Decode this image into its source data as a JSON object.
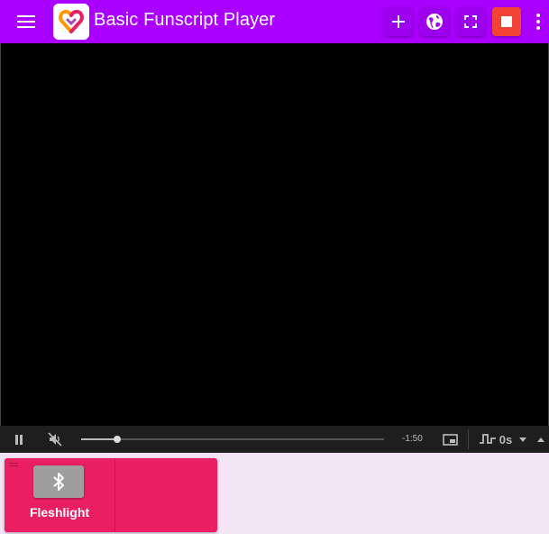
{
  "header": {
    "title": "Basic Funscript Player",
    "menu_icon": "menu-icon",
    "logo_icon": "heart-logo-icon",
    "actions": [
      {
        "name": "add-button",
        "icon": "plus-icon"
      },
      {
        "name": "web-button",
        "icon": "globe-icon"
      },
      {
        "name": "fullscreen-button",
        "icon": "fullscreen-icon"
      },
      {
        "name": "stop-button",
        "icon": "stop-icon"
      },
      {
        "name": "more-button",
        "icon": "more-vertical-icon"
      }
    ],
    "colors": {
      "bar": "#aa00ff",
      "stop": "#f44336"
    }
  },
  "player": {
    "time_remaining": "-1:50",
    "progress": 0.12,
    "muted": true,
    "offset": "0s"
  },
  "devices": [
    {
      "name": "Fleshlight",
      "connection_icon": "bluetooth-icon",
      "color": "#e91e63"
    }
  ]
}
